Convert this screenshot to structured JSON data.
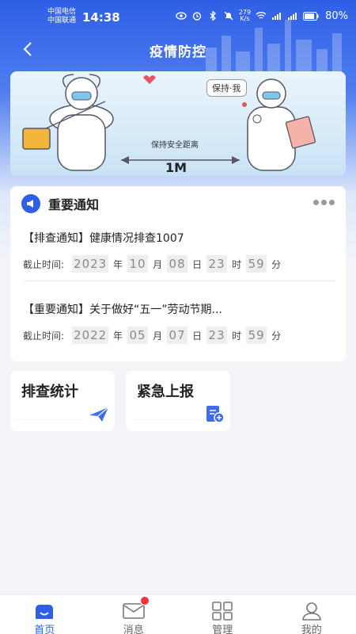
{
  "status_bar": {
    "carrier_1": "中国电信",
    "carrier_2": "中国联通",
    "time": "14:38",
    "net_speed_top": "279",
    "net_speed_bottom": "K/s",
    "battery": "80%"
  },
  "nav": {
    "title": "疫情防控",
    "back_icon": "chevron-left-icon"
  },
  "banner": {
    "speech_text": "保持·我",
    "distance_text": "保持安全距离",
    "distance_value": "1M"
  },
  "notice": {
    "title": "重要通知",
    "items": [
      {
        "title": "【排查通知】健康情况排查1007",
        "deadline_label": "截止时间:",
        "year": "2023",
        "year_unit": "年",
        "month": "10",
        "month_unit": "月",
        "day": "08",
        "day_unit": "日",
        "hour": "23",
        "hour_unit": "时",
        "minute": "59",
        "minute_unit": "分"
      },
      {
        "title": "【重要通知】关于做好“五一”劳动节期...",
        "deadline_label": "截止时间:",
        "year": "2022",
        "year_unit": "年",
        "month": "05",
        "month_unit": "月",
        "day": "07",
        "day_unit": "日",
        "hour": "23",
        "hour_unit": "时",
        "minute": "59",
        "minute_unit": "分"
      }
    ]
  },
  "quick_actions": [
    {
      "label": "排查统计",
      "icon": "paper-plane-icon"
    },
    {
      "label": "紧急上报",
      "icon": "report-add-icon"
    }
  ],
  "tabs": [
    {
      "label": "首页",
      "icon": "home-icon",
      "active": true
    },
    {
      "label": "消息",
      "icon": "mail-icon",
      "active": false
    },
    {
      "label": "管理",
      "icon": "grid-icon",
      "active": false
    },
    {
      "label": "我的",
      "icon": "user-icon",
      "active": false
    }
  ],
  "colors": {
    "primary": "#2f5fe6",
    "badge": "#f5313b"
  }
}
